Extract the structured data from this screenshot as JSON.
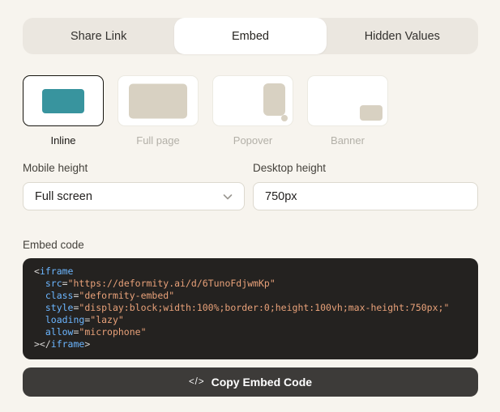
{
  "colors": {
    "page_bg": "#f7f4ee",
    "tabbar_bg": "#ebe7e0",
    "accent_teal": "#38949e",
    "thumb_beige": "#d8d1c2",
    "code_bg": "#242220",
    "tok_tag": "#6cb6ff",
    "tok_attr": "#6cb6ff",
    "tok_str": "#e8a179",
    "tok_pun": "#d6d4d2",
    "button_bg": "#3d3b39"
  },
  "tabs": {
    "items": [
      {
        "label": "Share Link",
        "active": false
      },
      {
        "label": "Embed",
        "active": true
      },
      {
        "label": "Hidden Values",
        "active": false
      }
    ]
  },
  "embed_types": {
    "items": [
      {
        "label": "Inline",
        "selected": true
      },
      {
        "label": "Full page",
        "selected": false
      },
      {
        "label": "Popover",
        "selected": false
      },
      {
        "label": "Banner",
        "selected": false
      }
    ]
  },
  "fields": {
    "mobile_height": {
      "label": "Mobile height",
      "value": "Full screen"
    },
    "desktop_height": {
      "label": "Desktop height",
      "value": "750px"
    }
  },
  "embed_code": {
    "label": "Embed code",
    "lines": [
      [
        {
          "c": "pun",
          "t": "<"
        },
        {
          "c": "tag",
          "t": "iframe"
        }
      ],
      [
        {
          "c": "pun",
          "t": "  "
        },
        {
          "c": "attr",
          "t": "src"
        },
        {
          "c": "pun",
          "t": "="
        },
        {
          "c": "str",
          "t": "\"https://deformity.ai/d/6TunoFdjwmKp\""
        }
      ],
      [
        {
          "c": "pun",
          "t": "  "
        },
        {
          "c": "attr",
          "t": "class"
        },
        {
          "c": "pun",
          "t": "="
        },
        {
          "c": "str",
          "t": "\"deformity-embed\""
        }
      ],
      [
        {
          "c": "pun",
          "t": "  "
        },
        {
          "c": "attr",
          "t": "style"
        },
        {
          "c": "pun",
          "t": "="
        },
        {
          "c": "str",
          "t": "\"display:block;width:100%;border:0;height:100vh;max-height:750px;\""
        }
      ],
      [
        {
          "c": "pun",
          "t": "  "
        },
        {
          "c": "attr",
          "t": "loading"
        },
        {
          "c": "pun",
          "t": "="
        },
        {
          "c": "str",
          "t": "\"lazy\""
        }
      ],
      [
        {
          "c": "pun",
          "t": "  "
        },
        {
          "c": "attr",
          "t": "allow"
        },
        {
          "c": "pun",
          "t": "="
        },
        {
          "c": "str",
          "t": "\"microphone\""
        }
      ],
      [
        {
          "c": "pun",
          "t": "></"
        },
        {
          "c": "tag",
          "t": "iframe"
        },
        {
          "c": "pun",
          "t": ">"
        }
      ]
    ]
  },
  "copy_button": {
    "label": "Copy Embed Code",
    "icon_glyph": "</>"
  }
}
